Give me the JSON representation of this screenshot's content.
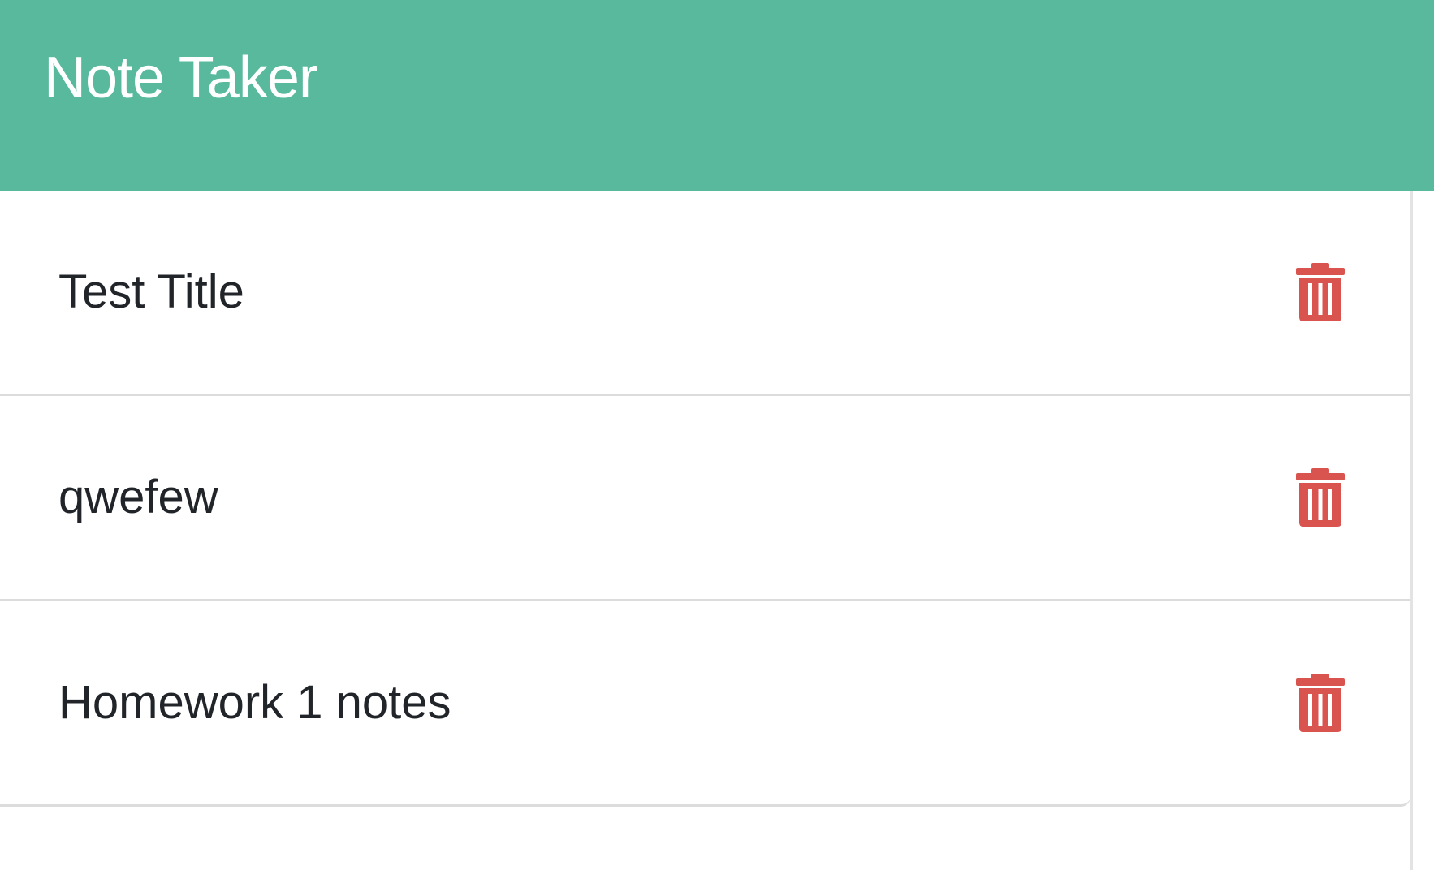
{
  "app": {
    "title": "Note Taker"
  },
  "theme": {
    "header_color": "#58b99d",
    "delete_color": "#d9534f",
    "text_color": "#212529"
  },
  "notes": [
    {
      "title": "Test Title",
      "delete_icon": "trash-icon"
    },
    {
      "title": "qwefew",
      "delete_icon": "trash-icon"
    },
    {
      "title": "Homework 1 notes",
      "delete_icon": "trash-icon"
    }
  ]
}
